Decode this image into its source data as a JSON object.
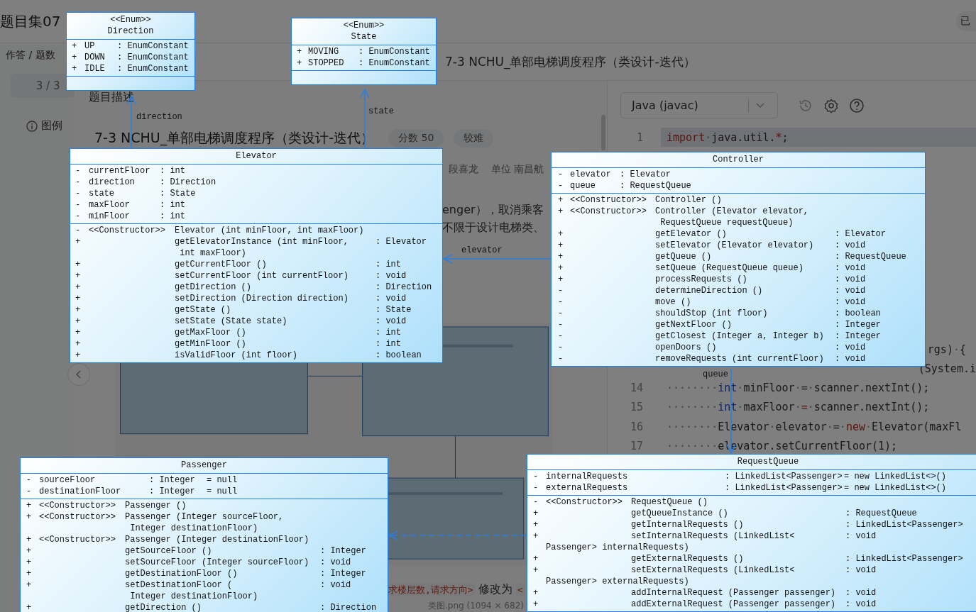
{
  "header": {
    "title": "题目集07",
    "status": "已"
  },
  "sidebar": {
    "progress_label": "作答 / 题数",
    "progress": "3 / 3",
    "legend": "图例"
  },
  "problem_title": "7-3 NCHU_单部电梯调度程序（类设计-迭代）",
  "description": {
    "tab": "题目描述",
    "title": "7-3 NCHU_单部电梯调度程序（类设计-迭代）",
    "badges": [
      "分数 50",
      "较难"
    ],
    "meta": [
      "段喜龙",
      "单位 南昌航"
    ],
    "text_lines": [
      "enger），取消乘客",
      "不限于设计电梯类、"
    ],
    "bottom_text": {
      "code_before": "求楼层数,请求方向>",
      "middle": "修改为",
      "code_after": "<"
    },
    "caption": "类图.png (1094 × 682)"
  },
  "editor": {
    "language": "Java (javac)",
    "lines": [
      {
        "number": "1",
        "current": true,
        "tokens": [
          {
            "kind": "keyword",
            "text": "import"
          },
          {
            "kind": "ws",
            "text": "·"
          },
          {
            "kind": "plain",
            "text": "java.util."
          },
          {
            "kind": "keyword",
            "text": "*"
          },
          {
            "kind": "plain",
            "text": ";"
          }
        ]
      },
      {
        "current": false,
        "tokens": [
          {
            "kind": "plain",
            "text": "rgs)"
          },
          {
            "kind": "ws",
            "text": "·"
          },
          {
            "kind": "plain",
            "text": "{"
          }
        ]
      },
      {
        "current": false,
        "tokens": [
          {
            "kind": "plain",
            "text": "(System.i"
          }
        ]
      },
      {
        "number": "14",
        "current": false,
        "tokens": [
          {
            "kind": "ws",
            "text": "········"
          },
          {
            "kind": "type",
            "text": "int"
          },
          {
            "kind": "ws",
            "text": "·"
          },
          {
            "kind": "plain",
            "text": "minFloor"
          },
          {
            "kind": "ws",
            "text": "·"
          },
          {
            "kind": "plain",
            "text": "="
          },
          {
            "kind": "ws",
            "text": "·"
          },
          {
            "kind": "plain",
            "text": "scanner.nextInt();"
          }
        ]
      },
      {
        "number": "15",
        "current": false,
        "tokens": [
          {
            "kind": "ws",
            "text": "········"
          },
          {
            "kind": "type",
            "text": "int"
          },
          {
            "kind": "ws",
            "text": "·"
          },
          {
            "kind": "plain",
            "text": "maxFloor"
          },
          {
            "kind": "ws",
            "text": "·"
          },
          {
            "kind": "keyword",
            "text": "="
          },
          {
            "kind": "ws",
            "text": "·"
          },
          {
            "kind": "plain",
            "text": "scanner.nextInt();"
          }
        ]
      },
      {
        "number": "16",
        "current": false,
        "tokens": [
          {
            "kind": "ws",
            "text": "········"
          },
          {
            "kind": "plain",
            "text": "Elevator"
          },
          {
            "kind": "ws",
            "text": "·"
          },
          {
            "kind": "plain",
            "text": "elevator"
          },
          {
            "kind": "ws",
            "text": "·"
          },
          {
            "kind": "plain",
            "text": "="
          },
          {
            "kind": "ws",
            "text": "·"
          },
          {
            "kind": "keyword",
            "text": "new"
          },
          {
            "kind": "ws",
            "text": "·"
          },
          {
            "kind": "plain",
            "text": "Elevator(maxFl"
          }
        ]
      },
      {
        "number": "17",
        "current": false,
        "tokens": [
          {
            "kind": "ws",
            "text": "········"
          },
          {
            "kind": "plain",
            "text": "elevator.setCurrentFloor(1);"
          }
        ]
      }
    ]
  },
  "diagram": {
    "classes": [
      {
        "stereotype": "<<Enum>>",
        "name": "Direction",
        "attributes": [
          {
            "vis": "+",
            "name": "UP",
            "type": ": EnumConstant"
          },
          {
            "vis": "+",
            "name": "DOWN",
            "type": ": EnumConstant"
          },
          {
            "vis": "+",
            "name": "IDLE",
            "type": ": EnumConstant"
          }
        ]
      },
      {
        "stereotype": "<<Enum>>",
        "name": "State",
        "attributes": [
          {
            "vis": "+",
            "name": "MOVING",
            "type": ": EnumConstant"
          },
          {
            "vis": "+",
            "name": "STOPPED",
            "type": ": EnumConstant"
          }
        ]
      },
      {
        "name": "Elevator",
        "attributes": [
          {
            "vis": "-",
            "name": "currentFloor",
            "type": ": int"
          },
          {
            "vis": "-",
            "name": "direction",
            "type": ": Direction"
          },
          {
            "vis": "-",
            "name": "state",
            "type": ": State"
          },
          {
            "vis": "-",
            "name": "maxFloor",
            "type": ": int"
          },
          {
            "vis": "-",
            "name": "minFloor",
            "type": ": int"
          }
        ],
        "methods": [
          {
            "vis": "-",
            "stereo": "<<Constructor>>",
            "sig": "Elevator (int minFloor, int maxFloor)"
          },
          {
            "vis": "+",
            "sig": "getElevatorInstance (int minFloor,",
            "type": ": Elevator",
            "wrap": "int maxFloor)"
          },
          {
            "vis": "+",
            "sig": "getCurrentFloor ()",
            "type": ": int"
          },
          {
            "vis": "+",
            "sig": "setCurrentFloor (int currentFloor)",
            "type": ": void"
          },
          {
            "vis": "+",
            "sig": "getDirection ()",
            "type": ": Direction"
          },
          {
            "vis": "+",
            "sig": "setDirection (Direction direction)",
            "type": ": void"
          },
          {
            "vis": "+",
            "sig": "getState ()",
            "type": ": State"
          },
          {
            "vis": "+",
            "sig": "setState (State state)",
            "type": ": void"
          },
          {
            "vis": "+",
            "sig": "getMaxFloor ()",
            "type": ": int"
          },
          {
            "vis": "+",
            "sig": "getMinFloor ()",
            "type": ": int"
          },
          {
            "vis": "+",
            "sig": "isValidFloor (int floor)",
            "type": ": boolean"
          }
        ]
      },
      {
        "name": "Controller",
        "attributes": [
          {
            "vis": "-",
            "name": "elevator",
            "type": ": Elevator"
          },
          {
            "vis": "-",
            "name": "queue",
            "type": ": RequestQueue"
          }
        ],
        "methods": [
          {
            "vis": "+",
            "stereo": "<<Constructor>>",
            "sig": "Controller ()"
          },
          {
            "vis": "+",
            "stereo": "<<Constructor>>",
            "sig": "Controller (Elevator elevator,",
            "wrap": "RequestQueue requestQueue)"
          },
          {
            "vis": "+",
            "sig": "getElevator ()",
            "type": ": Elevator"
          },
          {
            "vis": "+",
            "sig": "setElevator (Elevator elevator)",
            "type": ": void"
          },
          {
            "vis": "+",
            "sig": "getQueue ()",
            "type": ": RequestQueue"
          },
          {
            "vis": "+",
            "sig": "setQueue (RequestQueue queue)",
            "type": ": void"
          },
          {
            "vis": "+",
            "sig": "processRequests ()",
            "type": ": void"
          },
          {
            "vis": "-",
            "sig": "determineDirection ()",
            "type": ": void"
          },
          {
            "vis": "-",
            "sig": "move ()",
            "type": ": void"
          },
          {
            "vis": "-",
            "sig": "shouldStop (int floor)",
            "type": ": boolean"
          },
          {
            "vis": "-",
            "sig": "getNextFloor ()",
            "type": ": Integer"
          },
          {
            "vis": "-",
            "sig": "getClosest (Integer a, Integer b)",
            "type": ": Integer"
          },
          {
            "vis": "-",
            "sig": "openDoors ()",
            "type": ": void"
          },
          {
            "vis": "-",
            "sig": "removeRequests (int currentFloor)",
            "type": ": void"
          }
        ]
      },
      {
        "name": "Passenger",
        "attributes": [
          {
            "vis": "-",
            "name": "sourceFloor",
            "type": ": Integer",
            "default": "= null"
          },
          {
            "vis": "-",
            "name": "destinationFloor",
            "type": ": Integer",
            "default": "= null"
          }
        ],
        "methods": [
          {
            "vis": "+",
            "stereo": "<<Constructor>>",
            "sig": "Passenger ()"
          },
          {
            "vis": "+",
            "stereo": "<<Constructor>>",
            "sig": "Passenger (Integer sourceFloor,",
            "wrap": "Integer destinationFloor)"
          },
          {
            "vis": "+",
            "stereo": "<<Constructor>>",
            "sig": "Passenger (Integer destinationFloor)"
          },
          {
            "vis": "+",
            "sig": "getSourceFloor ()",
            "type": ": Integer"
          },
          {
            "vis": "+",
            "sig": "setSourceFloor (Integer sourceFloor)",
            "type": ": void"
          },
          {
            "vis": "+",
            "sig": "getDestinationFloor ()",
            "type": ": Integer"
          },
          {
            "vis": "+",
            "sig": "setDestinationFloor (",
            "type": ": void",
            "wrap": "Integer destinationFloor)"
          },
          {
            "vis": "+",
            "sig": "getDirection ()",
            "type": ": Direction"
          }
        ]
      },
      {
        "name": "RequestQueue",
        "attributes": [
          {
            "vis": "-",
            "name": "internalRequests",
            "type": ": LinkedList<Passenger>",
            "default": "= new LinkedList<>()"
          },
          {
            "vis": "-",
            "name": "externalRequests",
            "type": ": LinkedList<Passenger>",
            "default": "= new LinkedList<>()"
          }
        ],
        "methods": [
          {
            "vis": "-",
            "stereo": "<<Constructor>>",
            "sig": "RequestQueue ()"
          },
          {
            "vis": "+",
            "sig": "getQueueInstance ()",
            "type": ": RequestQueue"
          },
          {
            "vis": "+",
            "sig": "getInternalRequests ()",
            "type": ": LinkedList<Passenger>"
          },
          {
            "vis": "+",
            "sig": "setInternalRequests (LinkedList<",
            "type": ": void",
            "wrap": "Passenger> internalRequests)"
          },
          {
            "vis": "+",
            "sig": "getExternalRequests ()",
            "type": ": LinkedList<Passenger>"
          },
          {
            "vis": "+",
            "sig": "setExternalRequests (LinkedList<",
            "type": ": void",
            "wrap": "Passenger> externalRequests)"
          },
          {
            "vis": "+",
            "sig": "addInternalRequest (Passenger passenger)",
            "type": ": void"
          },
          {
            "vis": "+",
            "sig": "addExternalRequest (Passenger passenger)",
            "type": ": void"
          }
        ]
      }
    ],
    "links": [
      {
        "kind": "association",
        "label": "direction"
      },
      {
        "kind": "association",
        "label": "state"
      },
      {
        "kind": "association",
        "label": "elevator"
      },
      {
        "kind": "association",
        "label": "queue"
      },
      {
        "kind": "dependency"
      }
    ]
  }
}
